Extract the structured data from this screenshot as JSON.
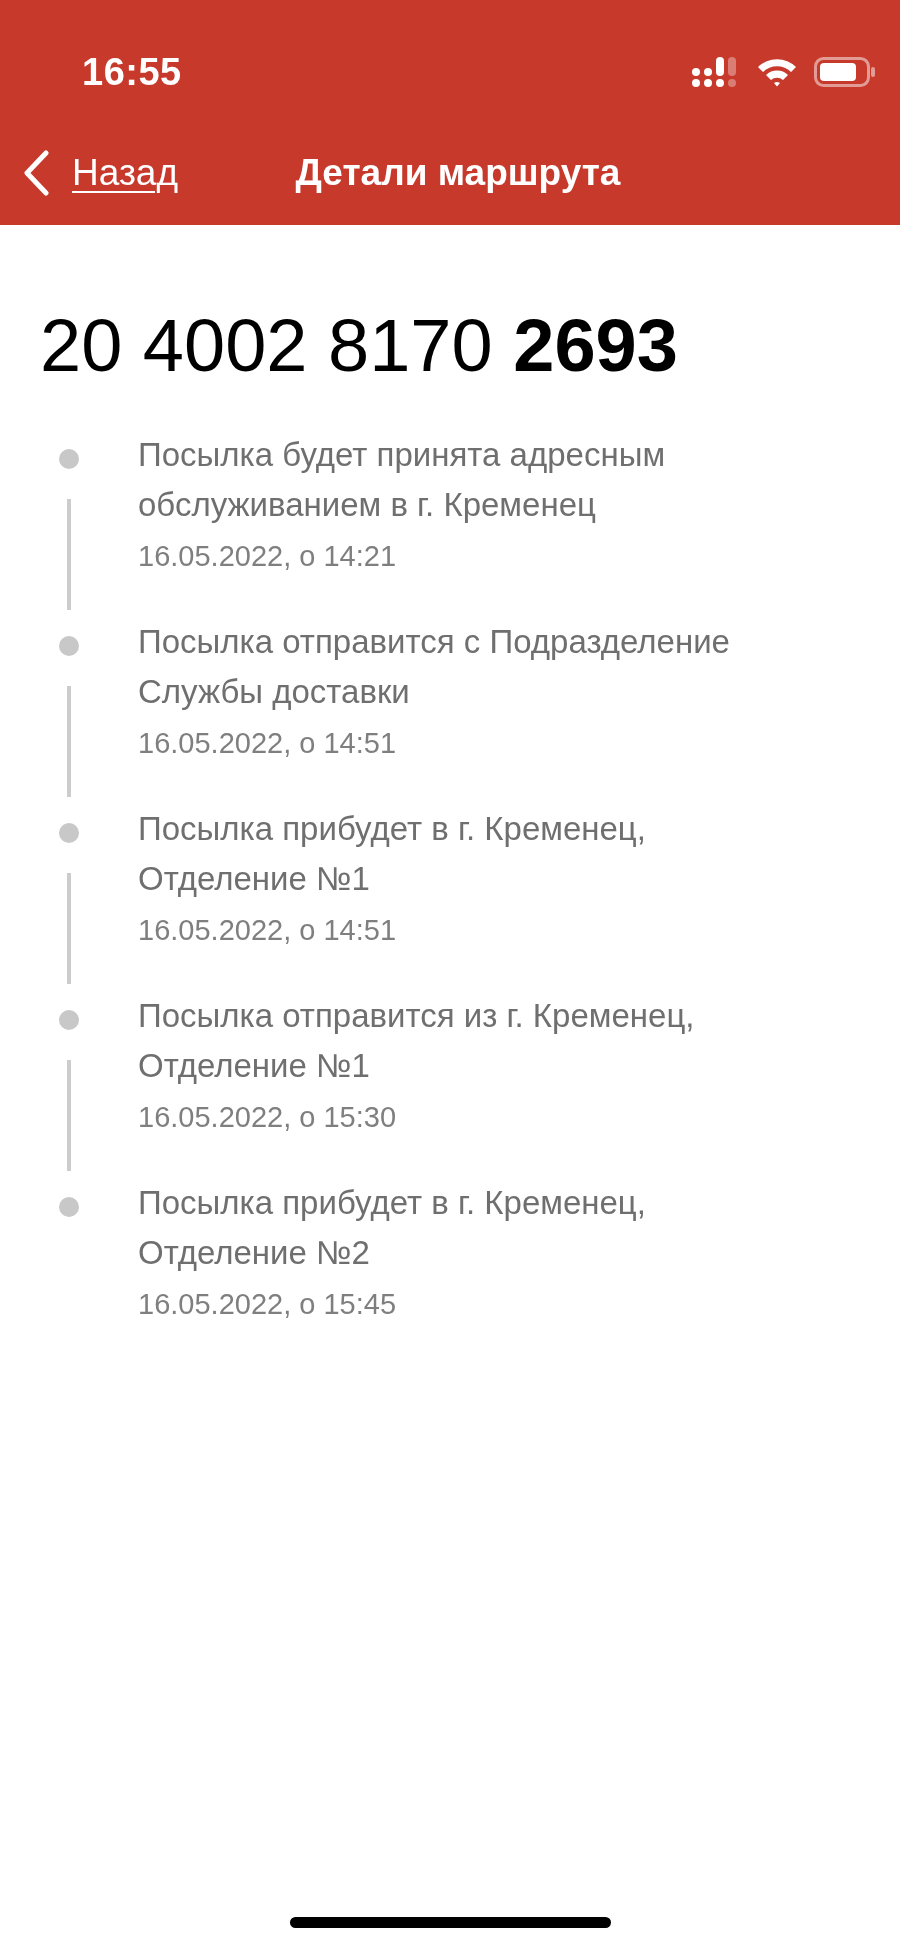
{
  "status_bar": {
    "time": "16:55"
  },
  "nav_bar": {
    "back_label": "Назад",
    "title": "Детали маршрута"
  },
  "tracking_number": "20 4002 8170 **2693**",
  "route_events": [
    {
      "description": "Посылка будет принята адресным обслуживанием в г. Кременец",
      "datetime": "16.05.2022, о 14:21"
    },
    {
      "description": "Посылка отправится с Подразделение Службы доставки",
      "datetime": "16.05.2022, о 14:51"
    },
    {
      "description": "Посылка прибудет в г. Кременец, Отделение №1",
      "datetime": "16.05.2022, о 14:51"
    },
    {
      "description": "Посылка отправится из г. Кременец, Отделение №1",
      "datetime": "16.05.2022, о 15:30"
    },
    {
      "description": "Посылка прибудет в г. Кременец, Отделение №2",
      "datetime": "16.05.2022, о 15:45"
    }
  ]
}
